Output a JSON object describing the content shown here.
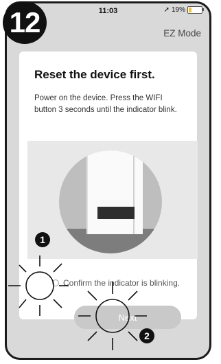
{
  "step_number": "12",
  "status_bar": {
    "time": "11:03",
    "location_icon": "navigation-arrow-icon",
    "battery": "19%"
  },
  "header": {
    "mode": "EZ Mode"
  },
  "card": {
    "title": "Reset the device first.",
    "description": "Power on the device. Press the WIFI button 3 seconds until the indicator blink.",
    "confirm_text": "Confirm the indicator is blinking.",
    "next_label": "Next"
  },
  "markers": {
    "first": "1",
    "second": "2"
  },
  "colors": {
    "frame": "#1b1b1b",
    "background": "#d9d9d9",
    "card": "#ffffff",
    "button": "#c9c9c9",
    "battery_fill": "#f4c430"
  }
}
